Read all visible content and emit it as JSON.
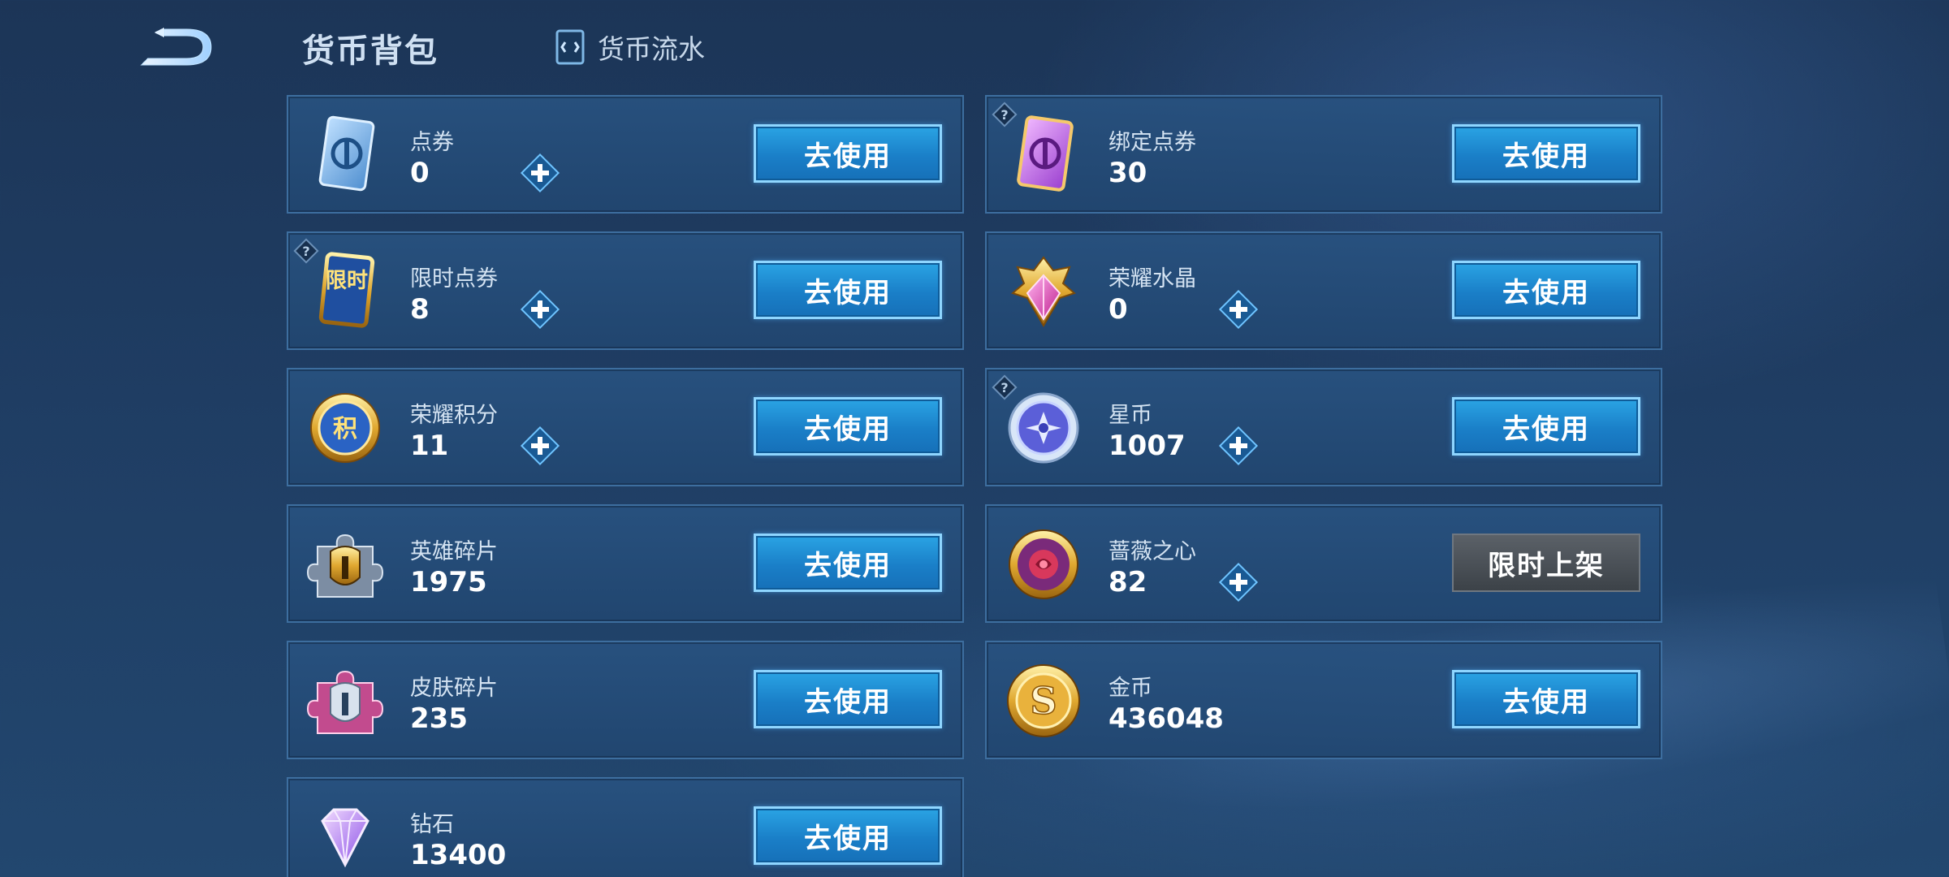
{
  "header": {
    "title": "货币背包",
    "flow_tab_label": "货币流水"
  },
  "colors": {
    "button_blue": "#1a7fc8",
    "button_border": "#8fd6ff",
    "card_bg": "#28527f",
    "card_border": "#3d6e9f",
    "disabled_button": "#4a5057"
  },
  "currencies": [
    {
      "name": "点券",
      "amount": "0",
      "icon": "coupon-icon",
      "has_help": false,
      "has_plus": true,
      "button": "去使用"
    },
    {
      "name": "绑定点券",
      "amount": "30",
      "icon": "bound-coupon-icon",
      "has_help": true,
      "has_plus": false,
      "button": "去使用"
    },
    {
      "name": "限时点券",
      "amount": "8",
      "icon": "limited-coupon-icon",
      "icon_text": "限时",
      "has_help": true,
      "has_plus": true,
      "button": "去使用"
    },
    {
      "name": "荣耀水晶",
      "amount": "0",
      "icon": "glory-crystal-icon",
      "has_help": false,
      "has_plus": true,
      "button": "去使用"
    },
    {
      "name": "荣耀积分",
      "amount": "11",
      "icon": "glory-points-icon",
      "icon_text": "积",
      "has_help": false,
      "has_plus": true,
      "button": "去使用"
    },
    {
      "name": "星币",
      "amount": "1007",
      "icon": "star-coin-icon",
      "has_help": true,
      "has_plus": true,
      "button": "去使用"
    },
    {
      "name": "英雄碎片",
      "amount": "1975",
      "icon": "hero-fragment-icon",
      "has_help": false,
      "has_plus": false,
      "button": "去使用"
    },
    {
      "name": "蔷薇之心",
      "amount": "82",
      "icon": "rose-heart-icon",
      "has_help": false,
      "has_plus": true,
      "button": "限时上架"
    },
    {
      "name": "皮肤碎片",
      "amount": "235",
      "icon": "skin-fragment-icon",
      "has_help": false,
      "has_plus": false,
      "button": "去使用"
    },
    {
      "name": "金币",
      "amount": "436048",
      "icon": "gold-coin-icon",
      "icon_text": "S",
      "has_help": false,
      "has_plus": false,
      "button": "去使用"
    },
    {
      "name": "钻石",
      "amount": "13400",
      "icon": "diamond-icon",
      "has_help": false,
      "has_plus": false,
      "button": "去使用"
    }
  ]
}
